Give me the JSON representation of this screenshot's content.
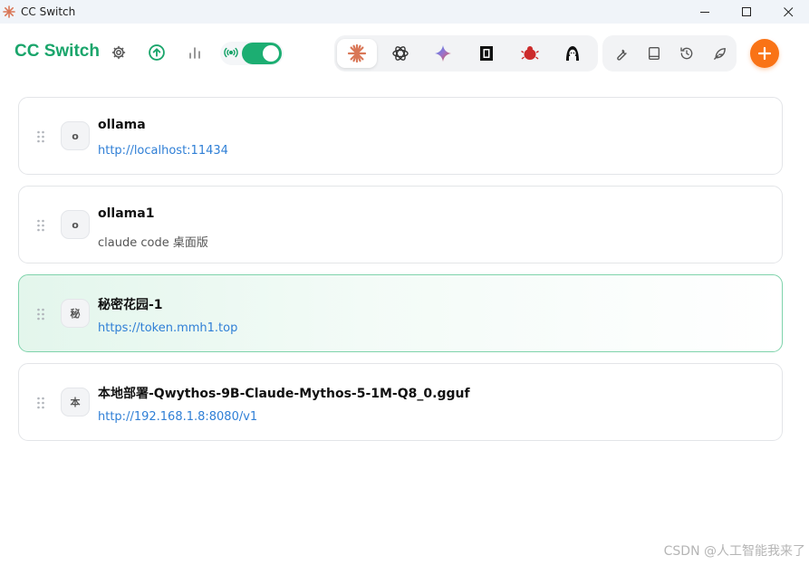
{
  "window": {
    "title": "CC Switch",
    "minimize_label": "—",
    "maximize_label": "☐",
    "close_label": "✕"
  },
  "header": {
    "brand": "CC Switch",
    "proxy_toggle_on": true,
    "accent_color": "#1aa56b",
    "add_button_label": "+",
    "add_button_color": "#f97316"
  },
  "app_tabs": [
    {
      "name": "claude-icon",
      "active": true
    },
    {
      "name": "openai-icon",
      "active": false
    },
    {
      "name": "gemini-icon",
      "active": false
    },
    {
      "name": "opencode-icon",
      "active": false
    },
    {
      "name": "bug-icon",
      "active": false
    },
    {
      "name": "hacker-icon",
      "active": false
    }
  ],
  "tools": [
    {
      "name": "wrench-icon"
    },
    {
      "name": "book-icon"
    },
    {
      "name": "history-icon"
    },
    {
      "name": "feather-icon"
    }
  ],
  "providers": [
    {
      "avatar": "o",
      "name": "ollama",
      "url": "http://localhost:11434",
      "url_is_link": true,
      "active": false
    },
    {
      "avatar": "o",
      "name": "ollama1",
      "url": "claude code 桌面版",
      "url_is_link": false,
      "active": false
    },
    {
      "avatar": "秘",
      "name": "秘密花园-1",
      "url": "https://token.mmh1.top",
      "url_is_link": true,
      "active": true
    },
    {
      "avatar": "本",
      "name": "本地部署-Qwythos-9B-Claude-Mythos-5-1M-Q8_0.gguf",
      "url": "http://192.168.1.8:8080/v1",
      "url_is_link": true,
      "active": false
    }
  ],
  "watermark": "CSDN @人工智能我来了"
}
